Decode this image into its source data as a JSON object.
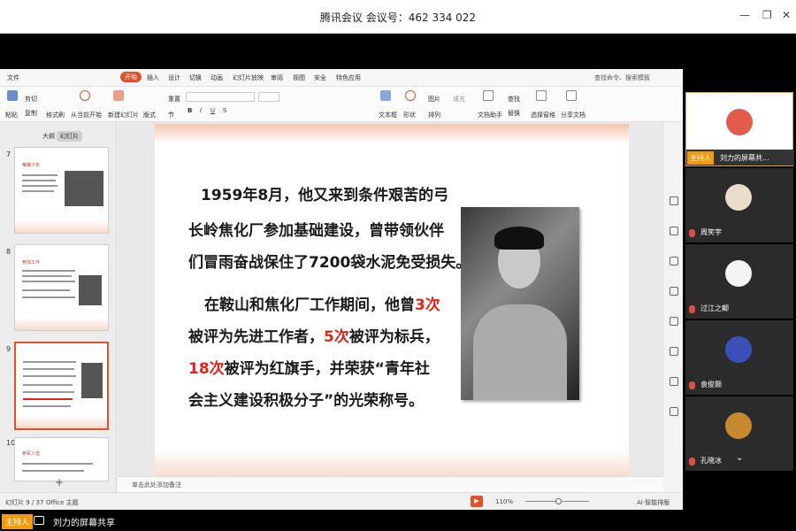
{
  "window": {
    "title": "腾讯会议 会议号：462 334 022"
  },
  "menu": {
    "file": "文件",
    "tabs": [
      "开始",
      "插入",
      "设计",
      "切换",
      "动画",
      "幻灯片放映",
      "审阅",
      "视图",
      "安全",
      "特色应用"
    ],
    "search": "查找命令、搜索模板"
  },
  "ribbon": {
    "paste": "粘贴",
    "cut": "剪切",
    "copy": "复制",
    "format_painter": "格式刷",
    "play_from": "从当前开始",
    "new_slide": "新建幻灯片",
    "layout": "版式",
    "section": "节",
    "reset": "重置",
    "text_box": "文本框",
    "shape": "形状",
    "arrange": "排列",
    "picture": "图片",
    "fill": "填充",
    "find": "查找",
    "replace": "替换",
    "doc_assistant": "文档助手",
    "select_pane": "选择窗格",
    "share_doc": "分享文档"
  },
  "sidebar": {
    "tab_outline": "大纲",
    "tab_slides": "幻灯片",
    "thumbs": [
      {
        "num": "7",
        "heading": "雏鹰少年"
      },
      {
        "num": "8",
        "heading": "参加工作"
      },
      {
        "num": "9",
        "heading": ""
      },
      {
        "num": "10",
        "heading": "参军入伍"
      }
    ]
  },
  "slide": {
    "para1": [
      "1959年8月，他又来到条件艰苦的弓",
      "长岭焦化厂参加基础建设，曾带领伙伴",
      "们冒雨奋战保住了7200袋水泥免受损失。"
    ],
    "p2_l1_a": "在鞍山和焦化厂工作期间，他曾",
    "p2_l1_red": "3次",
    "p2_l2_a": "被评为先进工作者，",
    "p2_l2_red": "5次",
    "p2_l2_b": "被评为标兵，",
    "p2_l3_red": "18次",
    "p2_l3_b": "被评为红旗手，并荣获“青年社",
    "p2_l4": "会主义建设积极分子”的光荣称号。"
  },
  "notes": {
    "placeholder": "单击此处添加备注"
  },
  "status": {
    "slide_info": "幻灯片 9 / 37",
    "theme": "Office 主题",
    "zoom": "110%",
    "ai": "AI·智能排版"
  },
  "participants": {
    "host_label": "主持人",
    "host_share": "刘力的屏幕共...",
    "others": [
      "周笑宇",
      "过江之鲫",
      "袁俊颢",
      "孔晓冰"
    ]
  },
  "bottom": {
    "badge": "主持人",
    "share": "刘力的屏幕共享"
  },
  "colors": {
    "accent": "#e0522b",
    "highlight": "#e0251b",
    "host_badge": "#f29b0d"
  }
}
